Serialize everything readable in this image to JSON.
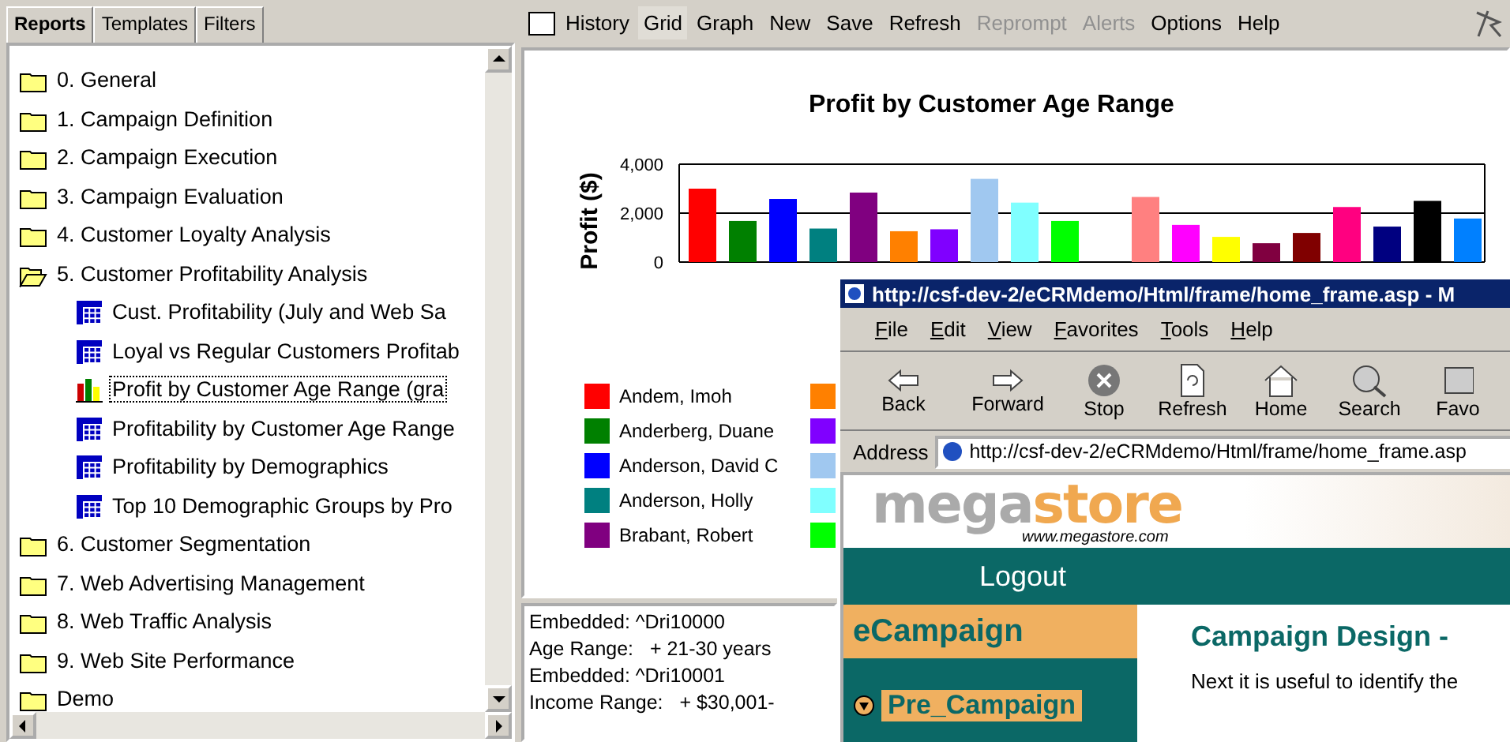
{
  "left_panel": {
    "tabs": [
      {
        "label": "Reports",
        "selected": true
      },
      {
        "label": "Templates",
        "selected": false
      },
      {
        "label": "Filters",
        "selected": false
      }
    ],
    "tree": [
      {
        "label": "0. General",
        "kind": "folder",
        "expanded": false
      },
      {
        "label": "1. Campaign Definition",
        "kind": "folder",
        "expanded": false
      },
      {
        "label": "2. Campaign Execution",
        "kind": "folder",
        "expanded": false
      },
      {
        "label": "3. Campaign Evaluation",
        "kind": "folder",
        "expanded": false
      },
      {
        "label": "4. Customer Loyalty Analysis",
        "kind": "folder",
        "expanded": false
      },
      {
        "label": "5. Customer Profitability Analysis",
        "kind": "folder",
        "expanded": true,
        "children": [
          {
            "label": "Cust. Profitability (July and Web Sa",
            "kind": "grid",
            "selected": false
          },
          {
            "label": "Loyal vs Regular Customers Profitab",
            "kind": "grid",
            "selected": false
          },
          {
            "label": "Profit by Customer Age Range (gra",
            "kind": "graph",
            "selected": true
          },
          {
            "label": "Profitability by Customer Age Range",
            "kind": "grid",
            "selected": false
          },
          {
            "label": "Profitability by Demographics",
            "kind": "grid",
            "selected": false
          },
          {
            "label": "Top 10 Demographic Groups by Pro",
            "kind": "grid",
            "selected": false
          }
        ]
      },
      {
        "label": "6. Customer Segmentation",
        "kind": "folder",
        "expanded": false
      },
      {
        "label": "7. Web Advertising Management",
        "kind": "folder",
        "expanded": false
      },
      {
        "label": "8. Web Traffic Analysis",
        "kind": "folder",
        "expanded": false
      },
      {
        "label": "9. Web Site Performance",
        "kind": "folder",
        "expanded": false
      },
      {
        "label": "Demo",
        "kind": "folder",
        "expanded": false
      }
    ]
  },
  "toolbar": {
    "checkbox": {
      "checked": false
    },
    "items": [
      {
        "label": "History",
        "selected": false,
        "disabled": false
      },
      {
        "label": "Grid",
        "selected": true,
        "disabled": false
      },
      {
        "label": "Graph",
        "selected": false,
        "disabled": false
      },
      {
        "label": "New",
        "selected": false,
        "disabled": false
      },
      {
        "label": "Save",
        "selected": false,
        "disabled": false
      },
      {
        "label": "Refresh",
        "selected": false,
        "disabled": false
      },
      {
        "label": "Reprompt",
        "selected": false,
        "disabled": true
      },
      {
        "label": "Alerts",
        "selected": false,
        "disabled": true
      },
      {
        "label": "Options",
        "selected": false,
        "disabled": false
      },
      {
        "label": "Help",
        "selected": false,
        "disabled": false
      }
    ]
  },
  "report": {
    "chart_data": {
      "type": "bar",
      "legend": true,
      "title": "Profit by Customer Age Range",
      "ylabel": "Profit ($)",
      "ylim": [
        0,
        4000
      ],
      "yticks": [
        {
          "value": 0,
          "label": "0"
        },
        {
          "value": 2000,
          "label": "2,000"
        },
        {
          "value": 4000,
          "label": "4,000"
        }
      ],
      "series": [
        {
          "name": "Andem, Imoh",
          "color": "#ff0000",
          "values": [
            3000
          ]
        },
        {
          "name": "Anderberg, Duane",
          "color": "#008000",
          "values": [
            1680
          ]
        },
        {
          "name": "Anderson, David C",
          "color": "#0000ff",
          "values": [
            2580
          ]
        },
        {
          "name": "Anderson, Holly",
          "color": "#008080",
          "values": [
            1370
          ]
        },
        {
          "name": "Brabant, Robert",
          "color": "#800080",
          "values": [
            2840
          ]
        },
        {
          "color": "#ff8000",
          "values": [
            1260
          ]
        },
        {
          "color": "#8000ff",
          "values": [
            1340
          ]
        },
        {
          "color": "#a0c8f0",
          "values": [
            3400
          ]
        },
        {
          "color": "#80ffff",
          "values": [
            2430
          ]
        },
        {
          "color": "#00ff00",
          "values": [
            1680
          ]
        },
        {
          "values": [
            null
          ]
        },
        {
          "color": "#ff8080",
          "values": [
            2660
          ]
        },
        {
          "color": "#ff00ff",
          "values": [
            1520
          ]
        },
        {
          "color": "#ffff00",
          "values": [
            1030
          ]
        },
        {
          "color": "#800040",
          "values": [
            770
          ]
        },
        {
          "color": "#800000",
          "values": [
            1190
          ]
        },
        {
          "color": "#ff0080",
          "values": [
            2250
          ]
        },
        {
          "color": "#000080",
          "values": [
            1450
          ]
        },
        {
          "color": "#000000",
          "values": [
            2500
          ]
        },
        {
          "color": "#0080ff",
          "values": [
            1780
          ]
        }
      ]
    }
  },
  "details": [
    "Embedded: ^Dri10000",
    "Age Range:   + 21-30 years",
    "Embedded: ^Dri10001",
    "Income Range:   + $30,001-"
  ],
  "browser": {
    "title": "http://csf-dev-2/eCRMdemo/Html/frame/home_frame.asp - M",
    "menu": [
      "File",
      "Edit",
      "View",
      "Favorites",
      "Tools",
      "Help"
    ],
    "buttons": [
      {
        "label": "Back",
        "kind": "back"
      },
      {
        "label": "Forward",
        "kind": "forward"
      },
      {
        "label": "Stop",
        "kind": "stop"
      },
      {
        "label": "Refresh",
        "kind": "refresh"
      },
      {
        "label": "Home",
        "kind": "home"
      },
      {
        "label": "Search",
        "kind": "search"
      },
      {
        "label": "Favo",
        "kind": "favorites"
      }
    ],
    "address_label": "Address",
    "address": "http://csf-dev-2/eCRMdemo/Html/frame/home_frame.asp",
    "page": {
      "logo_left": "mega",
      "logo_right": "store",
      "site": "www.megastore.com",
      "logout": "Logout",
      "section": "eCampaign",
      "nav_item": "Pre_Campaign",
      "heading": "Campaign Design -",
      "text": "Next it is useful to identify the"
    }
  }
}
